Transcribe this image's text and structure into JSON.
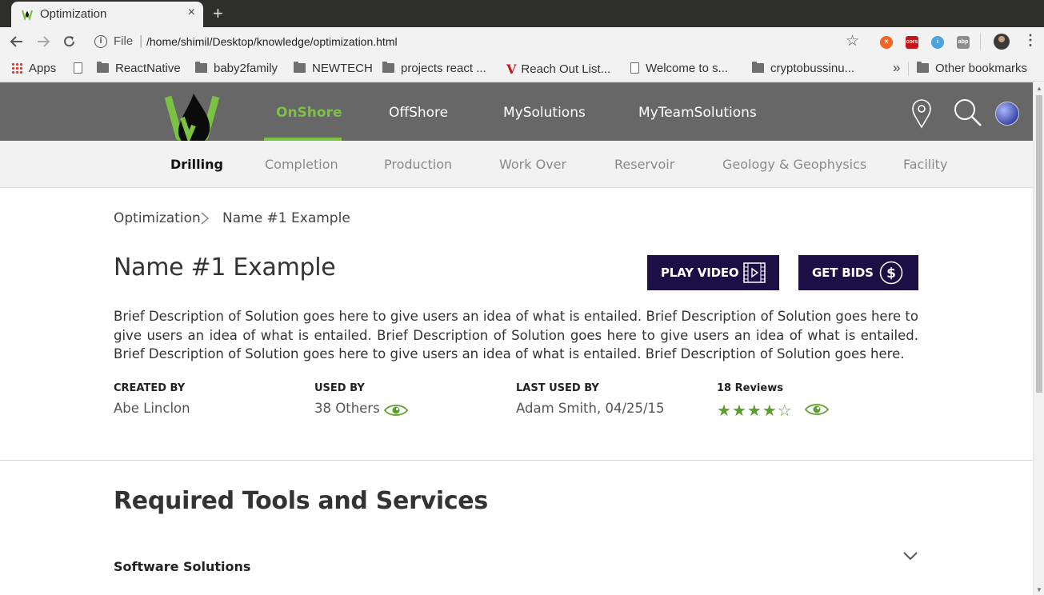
{
  "browser": {
    "tab_title": "Optimization",
    "tab_close": "×",
    "new_tab": "+",
    "url_scheme": "File",
    "url_separator": "|",
    "url": "/home/shimil/Desktop/knowledge/optimization.html",
    "extensions": [
      "cors",
      "abp"
    ],
    "bookmarks": [
      {
        "label": "Apps",
        "icon": "apps-grid-icon"
      },
      {
        "label": "",
        "icon": "page-icon"
      },
      {
        "label": "ReactNative",
        "icon": "folder-icon"
      },
      {
        "label": "baby2family",
        "icon": "folder-icon"
      },
      {
        "label": "NEWTECH",
        "icon": "folder-icon"
      },
      {
        "label": "projects react ...",
        "icon": "folder-icon"
      },
      {
        "label": "Reach Out List...",
        "icon": "v-icon"
      },
      {
        "label": "Welcome to s...",
        "icon": "page-icon"
      },
      {
        "label": "cryptobussinu...",
        "icon": "folder-icon"
      },
      {
        "label": "Other bookmarks",
        "icon": "folder-icon"
      }
    ],
    "more_bookmarks": "»"
  },
  "site": {
    "main_nav": [
      {
        "label": "OnShore",
        "active": true
      },
      {
        "label": "OffShore",
        "active": false
      },
      {
        "label": "MySolutions",
        "active": false
      },
      {
        "label": "MyTeamSolutions",
        "active": false
      }
    ],
    "sub_nav": [
      {
        "label": "Drilling",
        "active": true
      },
      {
        "label": "Completion",
        "active": false
      },
      {
        "label": "Production",
        "active": false
      },
      {
        "label": "Work Over",
        "active": false
      },
      {
        "label": "Reservoir",
        "active": false
      },
      {
        "label": "Geology & Geophysics",
        "active": false
      },
      {
        "label": "Facility",
        "active": false
      }
    ],
    "accent_color": "#7cc242",
    "button_color": "#1b0f45"
  },
  "breadcrumb": {
    "parent": "Optimization",
    "current": "Name #1 Example"
  },
  "solution": {
    "title": "Name #1 Example",
    "play_video_label": "PLAY VIDEO",
    "get_bids_label": "GET BIDS",
    "description": "Brief Description of Solution goes here to give users an idea of what is entailed. Brief Description of Solution goes here to give users an idea of what is entailed. Brief Description of Solution goes here to give users an idea of what is entailed. Brief Description of Solution goes here to give users an idea of what is entailed. Brief Description of Solution goes here.",
    "created_by_label": "CREATED BY",
    "created_by": "Abe Linclon",
    "used_by_label": "USED BY",
    "used_by": "38 Others",
    "last_used_label": "LAST USED BY",
    "last_used": "Adam Smith, 04/25/15",
    "reviews_label": "18 Reviews",
    "rating": 4,
    "rating_max": 5
  },
  "tools": {
    "section_title": "Required Tools and Services",
    "software_label": "Software Solutions"
  }
}
